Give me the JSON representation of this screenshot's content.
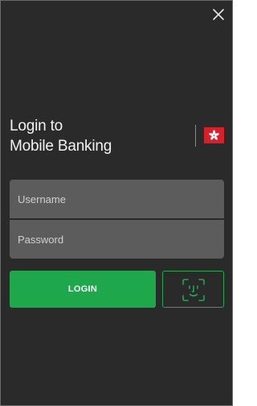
{
  "header": {
    "close_icon": "close-icon"
  },
  "title": {
    "line1": "Login to",
    "line2": "Mobile Banking"
  },
  "region": {
    "flag_icon": "hong-kong-flag-icon"
  },
  "form": {
    "username_placeholder": "Username",
    "username_value": "",
    "password_placeholder": "Password",
    "password_value": ""
  },
  "actions": {
    "login_label": "LOGIN",
    "face_id_icon": "face-id-icon"
  },
  "colors": {
    "background": "#2a2a2b",
    "field": "#5c5c5d",
    "accent_green": "#1ea84b",
    "flag_red": "#d81f2a"
  }
}
